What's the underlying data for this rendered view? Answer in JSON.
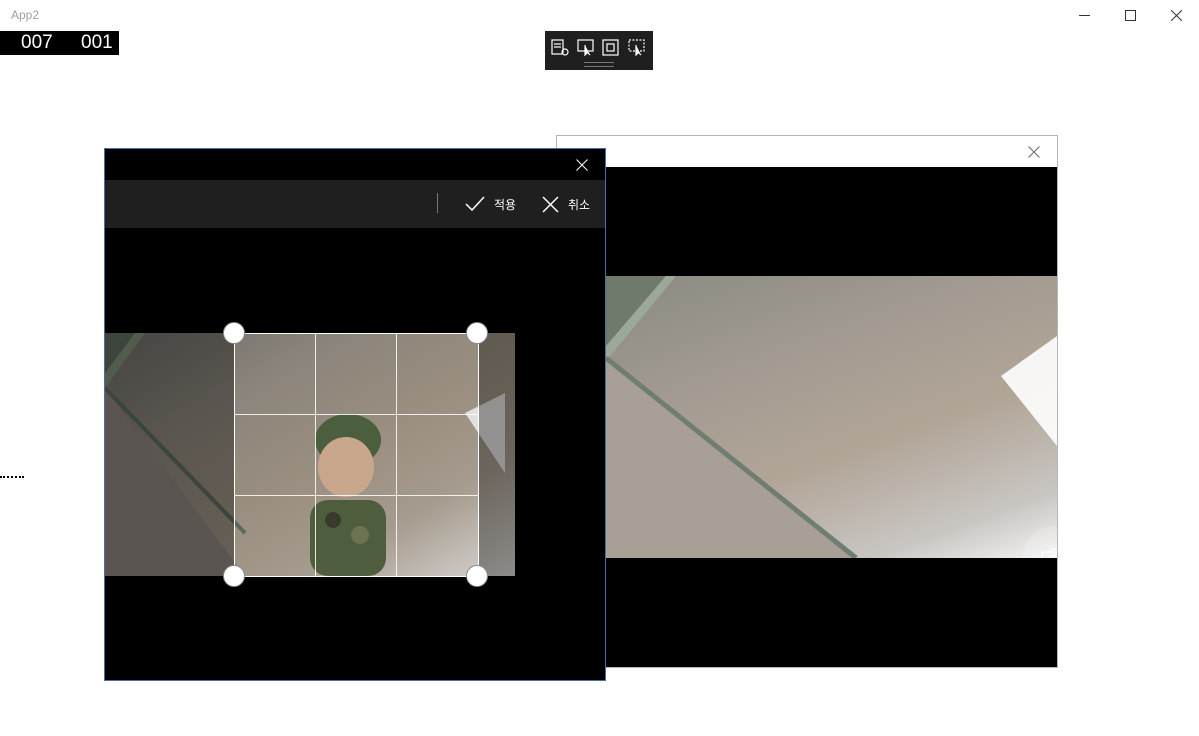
{
  "app": {
    "title": "App2",
    "window_controls": [
      "minimize-icon",
      "maximize-icon",
      "close-icon"
    ]
  },
  "frame_counter": {
    "left": "007",
    "right": "001"
  },
  "debug_toolbar": {
    "buttons": [
      "live-visual-tree-icon",
      "select-element-icon",
      "display-layout-adorners-icon",
      "track-focused-element-icon"
    ]
  },
  "camera_window": {
    "close_icon": "close-icon",
    "capture_icon": "camera-icon"
  },
  "crop_window": {
    "close_icon": "close-icon",
    "apply_label": "적용",
    "cancel_label": "취소",
    "apply_icon": "checkmark-icon",
    "cancel_icon": "close-icon"
  }
}
